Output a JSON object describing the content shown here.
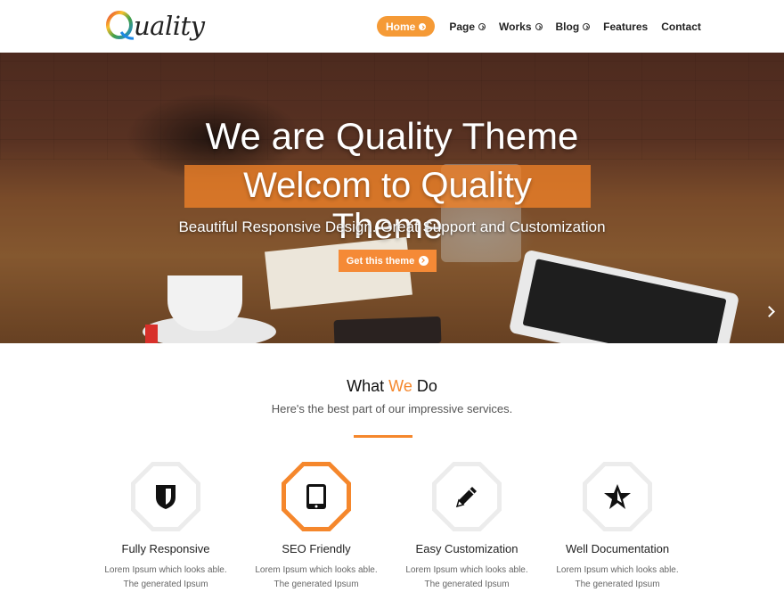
{
  "header": {
    "logo_letter": "Q",
    "logo_text": "uality",
    "nav": [
      {
        "label": "Home",
        "dropdown": true,
        "active": true
      },
      {
        "label": "Page",
        "dropdown": true
      },
      {
        "label": "Works",
        "dropdown": true
      },
      {
        "label": "Blog",
        "dropdown": true
      },
      {
        "label": "Features",
        "dropdown": false
      },
      {
        "label": "Contact",
        "dropdown": false
      }
    ]
  },
  "hero": {
    "title": "We are Quality Theme",
    "highlight_title": "Welcom to Quality Theme",
    "subtitle": "Beautiful Responsive Design. Great Support and Customization",
    "button_label": "Get this theme",
    "next_icon": "chevron-right-icon"
  },
  "what_we_do": {
    "title_part1": "What ",
    "title_accent": "We",
    "title_part2": " Do",
    "subtitle": "Here's the best part of our impressive services.",
    "services": [
      {
        "title": "Fully Responsive",
        "text": "Lorem Ipsum which looks able. The generated Ipsum",
        "icon": "shield-icon"
      },
      {
        "title": "SEO Friendly",
        "text": "Lorem Ipsum which looks able. The generated Ipsum",
        "icon": "tablet-icon"
      },
      {
        "title": "Easy Customization",
        "text": "Lorem Ipsum which looks able. The generated Ipsum",
        "icon": "pencil-icon"
      },
      {
        "title": "Well Documentation",
        "text": "Lorem Ipsum which looks able. The generated Ipsum",
        "icon": "star-icon"
      }
    ]
  },
  "colors": {
    "accent": "#f5872c",
    "nav_active": "#f59a36"
  }
}
